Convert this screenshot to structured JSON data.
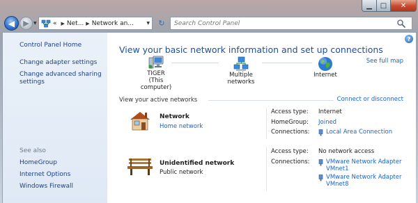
{
  "window": {
    "caption": {
      "minimize": "▁",
      "maximize": "□",
      "close": "✕"
    }
  },
  "nav": {
    "breadcrumb": {
      "overflow": "«",
      "item1": "Net...",
      "item2": "Network an..."
    },
    "search_placeholder": "Search Control Panel"
  },
  "sidebar": {
    "home": "Control Panel Home",
    "change_adapter": "Change adapter settings",
    "change_sharing_1": "Change advanced sharing",
    "change_sharing_2": "settings",
    "see_also_title": "See also",
    "see_also": [
      "HomeGroup",
      "Internet Options",
      "Windows Firewall"
    ]
  },
  "main": {
    "help": "?",
    "title": "View your basic network information and set up connections",
    "see_full_map": "See full map",
    "map": {
      "computer_name": "TIGER",
      "computer_sub": "(This computer)",
      "networks": "Multiple networks",
      "internet": "Internet"
    },
    "active_label": "View your active networks",
    "connect_link": "Connect or disconnect",
    "networks": [
      {
        "name": "Network",
        "type": "Home network",
        "access_type_label": "Access type:",
        "access_type": "Internet",
        "homegroup_label": "HomeGroup:",
        "homegroup": "Joined",
        "connections_label": "Connections:",
        "connection": "Local Area Connection"
      },
      {
        "name": "Unidentified network",
        "type": "Public network",
        "access_type_label": "Access type:",
        "access_type": "No network access",
        "connections_label": "Connections:",
        "connections": [
          {
            "line1": "VMware Network Adapter",
            "line2": "VMnet1"
          },
          {
            "line1": "VMware Network Adapter",
            "line2": "VMnet8"
          }
        ]
      }
    ]
  },
  "colors": {
    "link": "#1c63c7",
    "title": "#1d4f9c",
    "sidebar_link": "#1c3f8c",
    "sidebar_bg": "#e4edf7",
    "close_btn": "#c74a2c"
  }
}
